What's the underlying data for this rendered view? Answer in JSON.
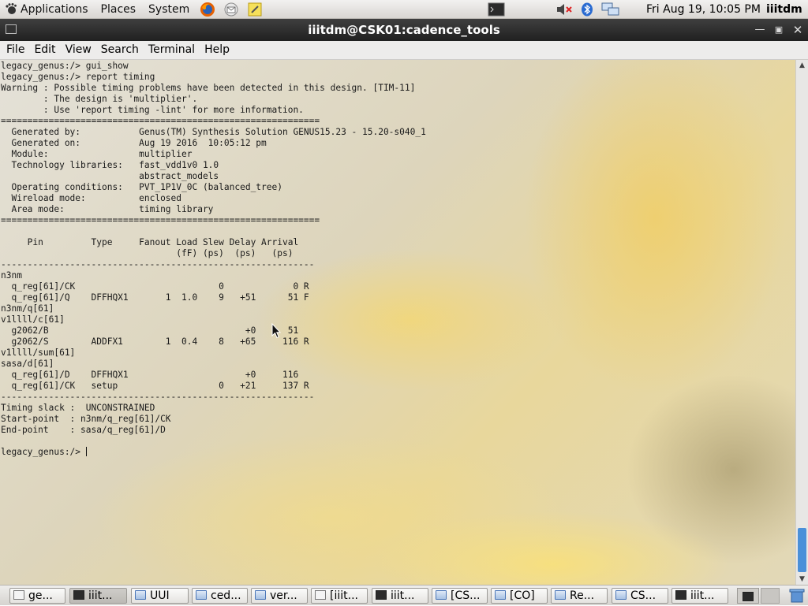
{
  "top_panel": {
    "menus": [
      "Applications",
      "Places",
      "System"
    ],
    "launcher_icons": [
      "firefox-icon",
      "mail-icon",
      "notes-icon"
    ],
    "tray_icons": [
      "terminal-tray-icon",
      "volume-muted-icon",
      "bluetooth-icon",
      "network-icon"
    ],
    "clock": "Fri Aug 19, 10:05 PM",
    "username": "iiitdm"
  },
  "window": {
    "title": "iiitdm@CSK01:cadence_tools",
    "controls": [
      "minimize",
      "maximize",
      "close"
    ]
  },
  "menubar": [
    "File",
    "Edit",
    "View",
    "Search",
    "Terminal",
    "Help"
  ],
  "terminal": {
    "lines": [
      "legacy_genus:/> gui_show",
      "legacy_genus:/> report timing",
      "Warning : Possible timing problems have been detected in this design. [TIM-11]",
      "        : The design is 'multiplier'.",
      "        : Use 'report timing -lint' for more information.",
      "============================================================",
      "  Generated by:           Genus(TM) Synthesis Solution GENUS15.23 - 15.20-s040_1",
      "  Generated on:           Aug 19 2016  10:05:12 pm",
      "  Module:                 multiplier",
      "  Technology libraries:   fast_vdd1v0 1.0",
      "                          abstract_models",
      "  Operating conditions:   PVT_1P1V_0C (balanced_tree)",
      "  Wireload mode:          enclosed",
      "  Area mode:              timing library",
      "============================================================",
      "",
      "     Pin         Type     Fanout Load Slew Delay Arrival",
      "                                 (fF) (ps)  (ps)   (ps)",
      "-----------------------------------------------------------",
      "n3nm",
      "  q_reg[61]/CK                           0             0 R",
      "  q_reg[61]/Q    DFFHQX1       1  1.0    9   +51      51 F",
      "n3nm/q[61]",
      "v1llll/c[61]",
      "  g2062/B                                     +0      51",
      "  g2062/S        ADDFX1        1  0.4    8   +65     116 R",
      "v1llll/sum[61]",
      "sasa/d[61]",
      "  q_reg[61]/D    DFFHQX1                      +0     116",
      "  q_reg[61]/CK   setup                   0   +21     137 R",
      "-----------------------------------------------------------",
      "Timing slack :  UNCONSTRAINED",
      "Start-point  : n3nm/q_reg[61]/CK",
      "End-point    : sasa/q_reg[61]/D",
      "",
      "legacy_genus:/> "
    ]
  },
  "taskbar": {
    "items": [
      {
        "label": "ge...",
        "icon": "text-editor-icon",
        "active": false
      },
      {
        "label": "iiit...",
        "icon": "terminal-icon",
        "active": true
      },
      {
        "label": "UUI",
        "icon": "folder-icon",
        "active": false
      },
      {
        "label": "ced...",
        "icon": "folder-icon",
        "active": false
      },
      {
        "label": "ver...",
        "icon": "folder-icon",
        "active": false
      },
      {
        "label": "[iiit...",
        "icon": "terminal-icon",
        "active": false
      },
      {
        "label": "iiit...",
        "icon": "terminal-icon",
        "active": false
      },
      {
        "label": "[CS...",
        "icon": "folder-icon",
        "active": false
      },
      {
        "label": "[CO]",
        "icon": "folder-icon",
        "active": false
      },
      {
        "label": "Re...",
        "icon": "folder-icon",
        "active": false
      },
      {
        "label": "CS...",
        "icon": "folder-icon",
        "active": false
      },
      {
        "label": "iiit...",
        "icon": "terminal-icon",
        "active": false
      }
    ],
    "tray": [
      "terminal-tray-icon",
      "workspace-switcher",
      "trash-icon"
    ]
  },
  "colors": {
    "scrollbar_thumb": "#4a90d9",
    "titlebar": "#2b2b2b"
  }
}
